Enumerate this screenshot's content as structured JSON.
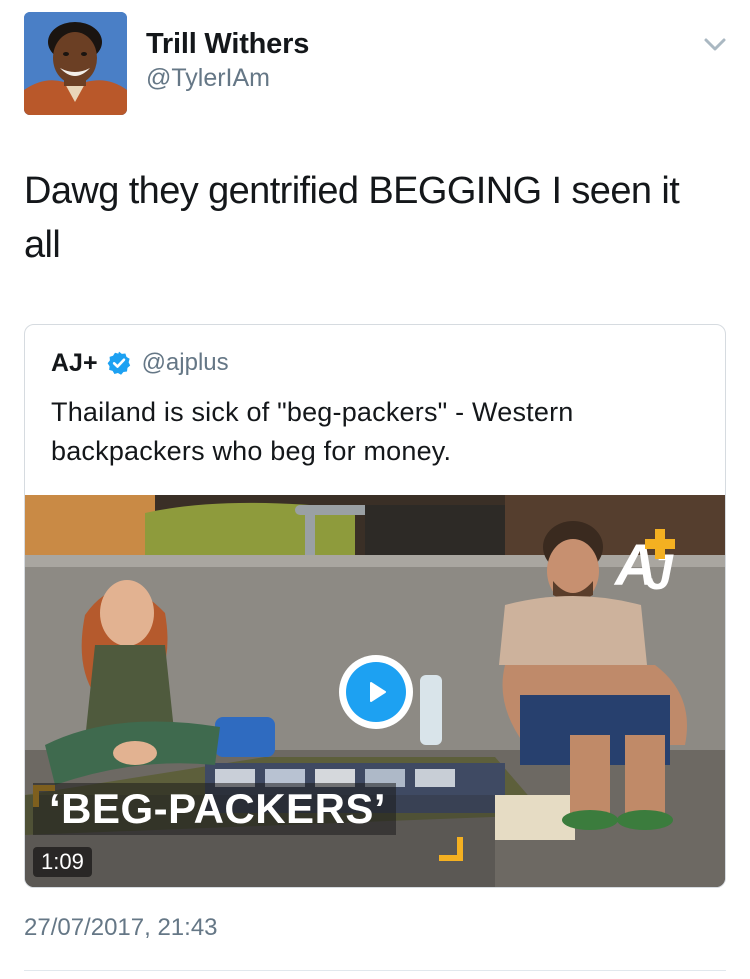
{
  "tweet": {
    "author": {
      "display_name": "Trill Withers",
      "handle": "@TylerIAm",
      "avatar": "profile-photo"
    },
    "text": "Dawg they gentrified BEGGING I seen it all",
    "menu_icon": "chevron-down-icon",
    "timestamp": "27/07/2017, 21:43"
  },
  "quoted_tweet": {
    "author_name": "AJ+",
    "verified": true,
    "verified_icon": "verified-badge-icon",
    "handle": "@ajplus",
    "text": "Thailand is sick of \"beg-packers\" - Western backpackers who beg for money.",
    "media": {
      "type": "video",
      "play_icon": "play-icon",
      "caption": "‘BEG-PACKERS’",
      "duration": "1:09",
      "logo": "AJ+"
    }
  },
  "colors": {
    "text_primary": "#14171a",
    "text_secondary": "#657786",
    "accent_blue": "#1da1f2",
    "caption_bracket": "#f4b021",
    "border": "#d6dbe0"
  }
}
